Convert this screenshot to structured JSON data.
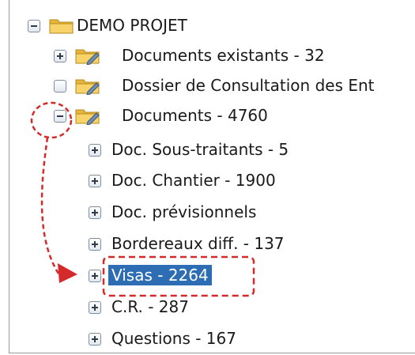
{
  "tree": {
    "root": {
      "label": "DEMO PROJET",
      "toggle": "minus"
    },
    "children": [
      {
        "label": "Documents existants - 32",
        "toggle": "plus",
        "icon": "folder-edit-icon"
      },
      {
        "label": "Dossier de Consultation des Ent",
        "toggle": "empty",
        "icon": "folder-edit-icon"
      },
      {
        "label": "Documents - 4760",
        "toggle": "minus",
        "icon": "folder-edit-icon"
      }
    ],
    "documents_children": [
      {
        "label": "Doc. Sous-traitants - 5",
        "toggle": "plus"
      },
      {
        "label": "Doc. Chantier - 1900",
        "toggle": "plus"
      },
      {
        "label": "Doc. prévisionnels",
        "toggle": "plus"
      },
      {
        "label": "Bordereaux diff. - 137",
        "toggle": "plus"
      },
      {
        "label": "Visas - 2264",
        "toggle": "plus",
        "selected": true
      },
      {
        "label": "C.R. - 287",
        "toggle": "plus"
      },
      {
        "label": "Questions - 167",
        "toggle": "plus"
      }
    ]
  },
  "colors": {
    "selection": "#2d6db4",
    "annotation": "#d42a2a",
    "folder": "#f0c24a"
  }
}
